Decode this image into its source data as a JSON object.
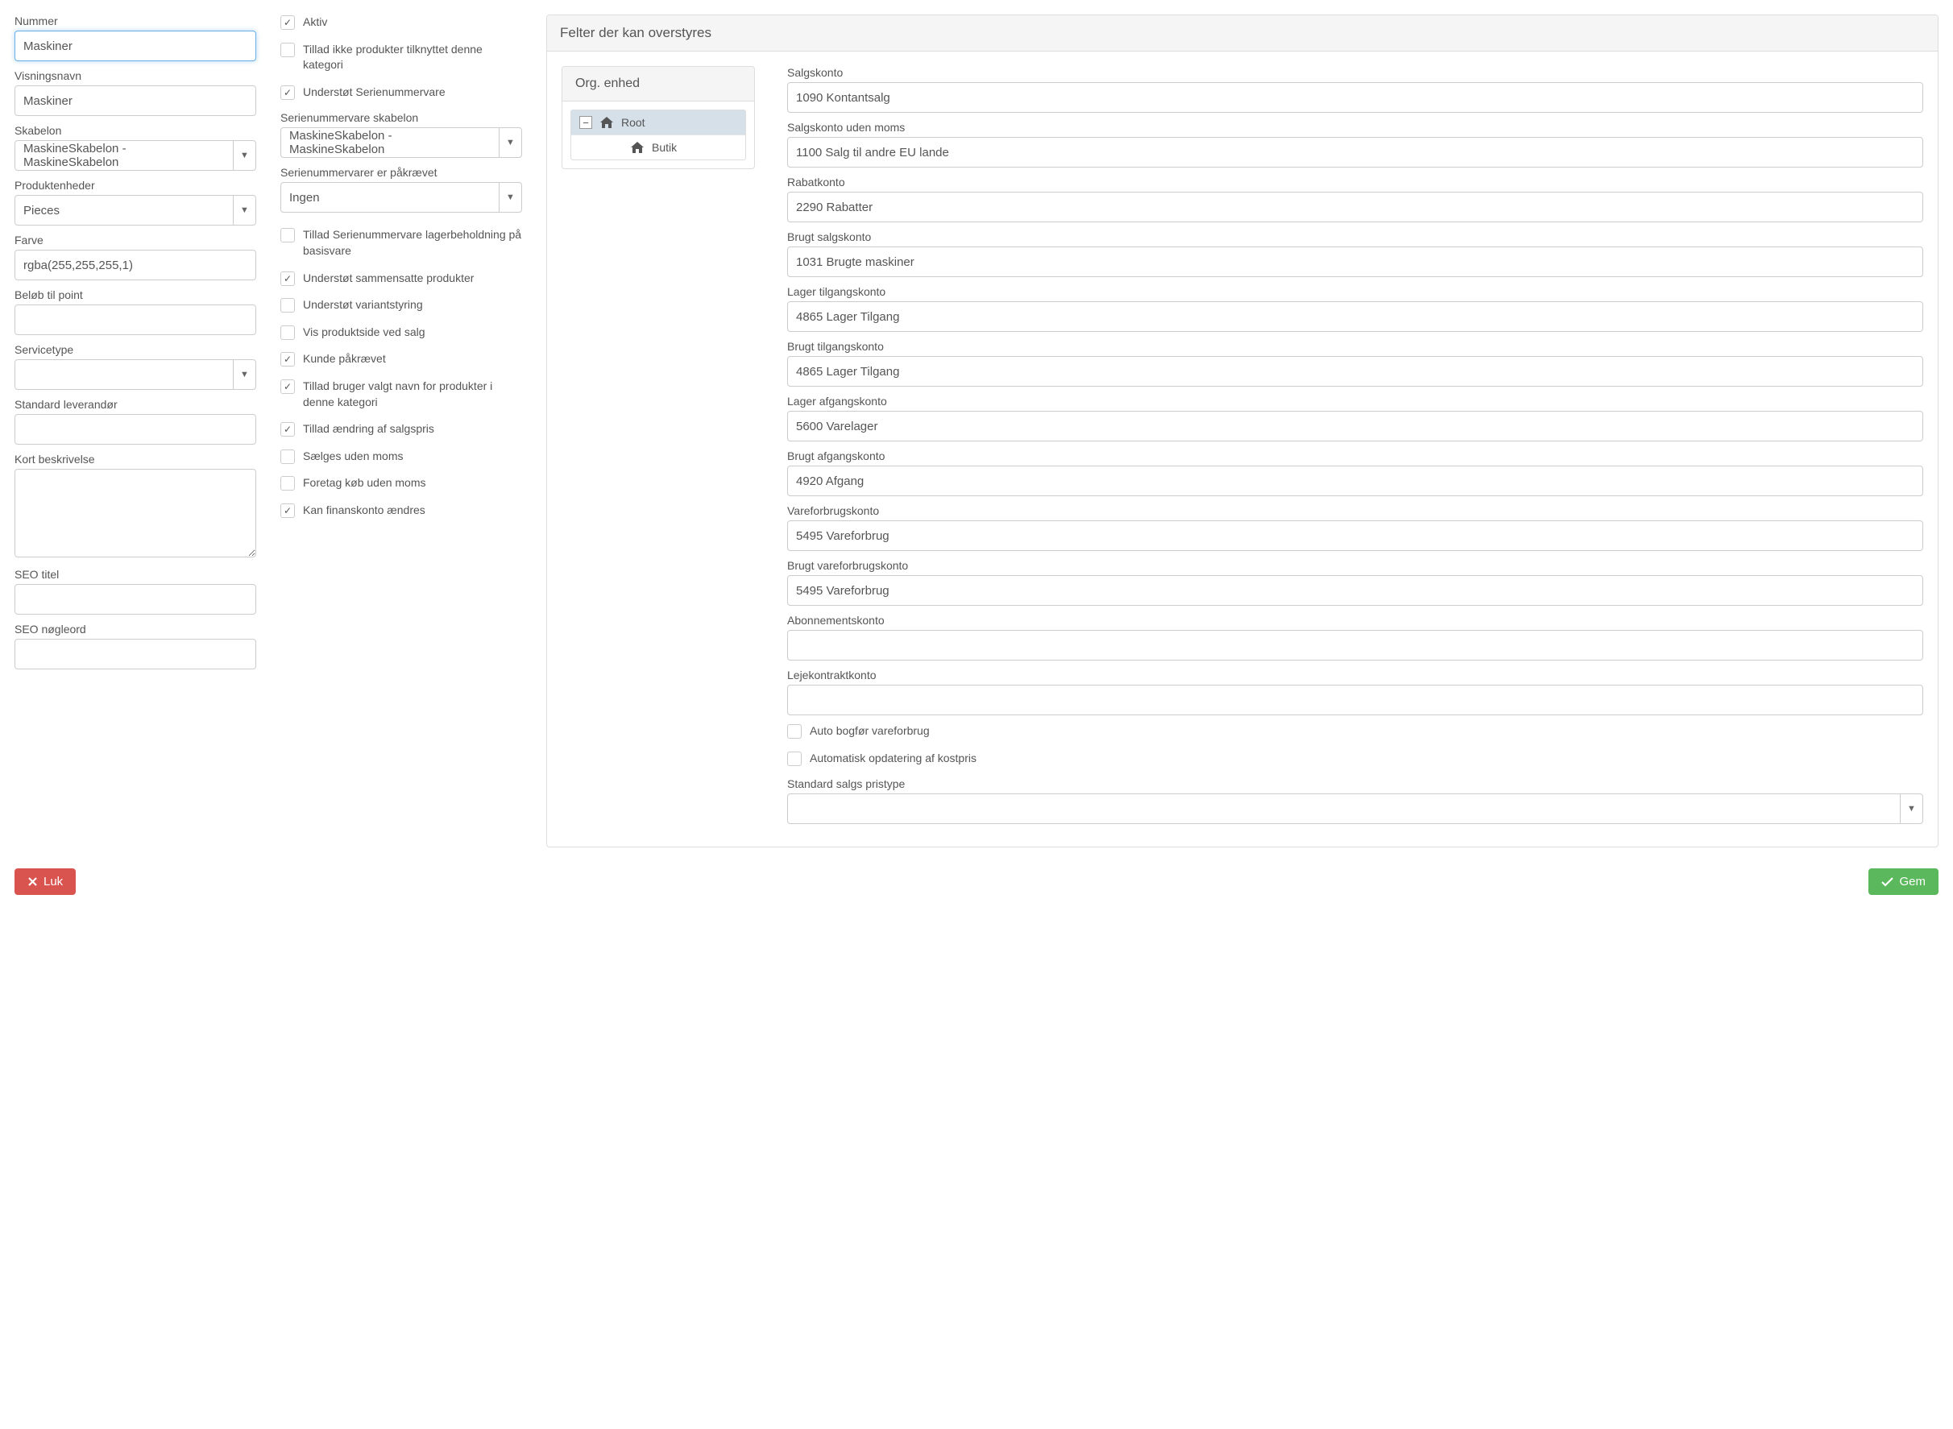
{
  "left": {
    "nummer_label": "Nummer",
    "nummer_value": "Maskiner",
    "visningsnavn_label": "Visningsnavn",
    "visningsnavn_value": "Maskiner",
    "skabelon_label": "Skabelon",
    "skabelon_value": "MaskineSkabelon - MaskineSkabelon",
    "produktenheder_label": "Produktenheder",
    "produktenheder_value": "Pieces",
    "farve_label": "Farve",
    "farve_value": "rgba(255,255,255,1)",
    "belob_label": "Beløb til point",
    "belob_value": "",
    "servicetype_label": "Servicetype",
    "servicetype_value": "",
    "leverandor_label": "Standard leverandør",
    "leverandor_value": "",
    "kort_label": "Kort beskrivelse",
    "seotitel_label": "SEO titel",
    "seotitel_value": "",
    "seonogle_label": "SEO nøgleord",
    "seonogle_value": ""
  },
  "mid": {
    "aktiv": "Aktiv",
    "tillad_ikke": "Tillad ikke produkter tilknyttet denne kategori",
    "understot_serie": "Understøt Serienummervare",
    "serievare_skabelon_label": "Serienummervare skabelon",
    "serievare_skabelon_value": "MaskineSkabelon - MaskineSkabelon",
    "serievarer_pakraevet_label": "Serienummervarer er påkrævet",
    "serievarer_pakraevet_value": "Ingen",
    "tillad_serie_lager": "Tillad Serienummervare lagerbeholdning på basisvare",
    "understot_sammensatte": "Understøt sammensatte produkter",
    "understot_variant": "Understøt variantstyring",
    "vis_produktside": "Vis produktside ved salg",
    "kunde_pakraevet": "Kunde påkrævet",
    "tillad_bruger_navn": "Tillad bruger valgt navn for produkter i denne kategori",
    "tillad_aendring_pris": "Tillad ændring af salgspris",
    "saelges_uden_moms": "Sælges uden moms",
    "foretag_kob_uden_moms": "Foretag køb uden moms",
    "kan_finanskonto": "Kan finanskonto ændres"
  },
  "right": {
    "panel_title": "Felter der kan overstyres",
    "org_enhed": "Org. enhed",
    "root": "Root",
    "butik": "Butik",
    "accounts": {
      "salgskonto_label": "Salgskonto",
      "salgskonto_value": "1090 Kontantsalg",
      "salgskonto_uden_label": "Salgskonto uden moms",
      "salgskonto_uden_value": "1100 Salg til andre EU lande",
      "rabatkonto_label": "Rabatkonto",
      "rabatkonto_value": "2290 Rabatter",
      "brugt_salg_label": "Brugt salgskonto",
      "brugt_salg_value": "1031 Brugte maskiner",
      "lager_tilgang_label": "Lager tilgangskonto",
      "lager_tilgang_value": "4865 Lager Tilgang",
      "brugt_tilgang_label": "Brugt tilgangskonto",
      "brugt_tilgang_value": "4865 Lager Tilgang",
      "lager_afgang_label": "Lager afgangskonto",
      "lager_afgang_value": "5600 Varelager",
      "brugt_afgang_label": "Brugt afgangskonto",
      "brugt_afgang_value": "4920 Afgang",
      "vareforbrug_label": "Vareforbrugskonto",
      "vareforbrug_value": "5495 Vareforbrug",
      "brugt_vareforbrug_label": "Brugt vareforbrugskonto",
      "brugt_vareforbrug_value": "5495 Vareforbrug",
      "abonnement_label": "Abonnementskonto",
      "abonnement_value": "",
      "lejekontrakt_label": "Lejekontraktkonto",
      "lejekontrakt_value": "",
      "auto_bogfor": "Auto bogfør vareforbrug",
      "auto_kostpris": "Automatisk opdatering af kostpris",
      "std_salgspris_label": "Standard salgs pristype",
      "std_salgspris_value": ""
    }
  },
  "footer": {
    "luk": "Luk",
    "gem": "Gem"
  }
}
